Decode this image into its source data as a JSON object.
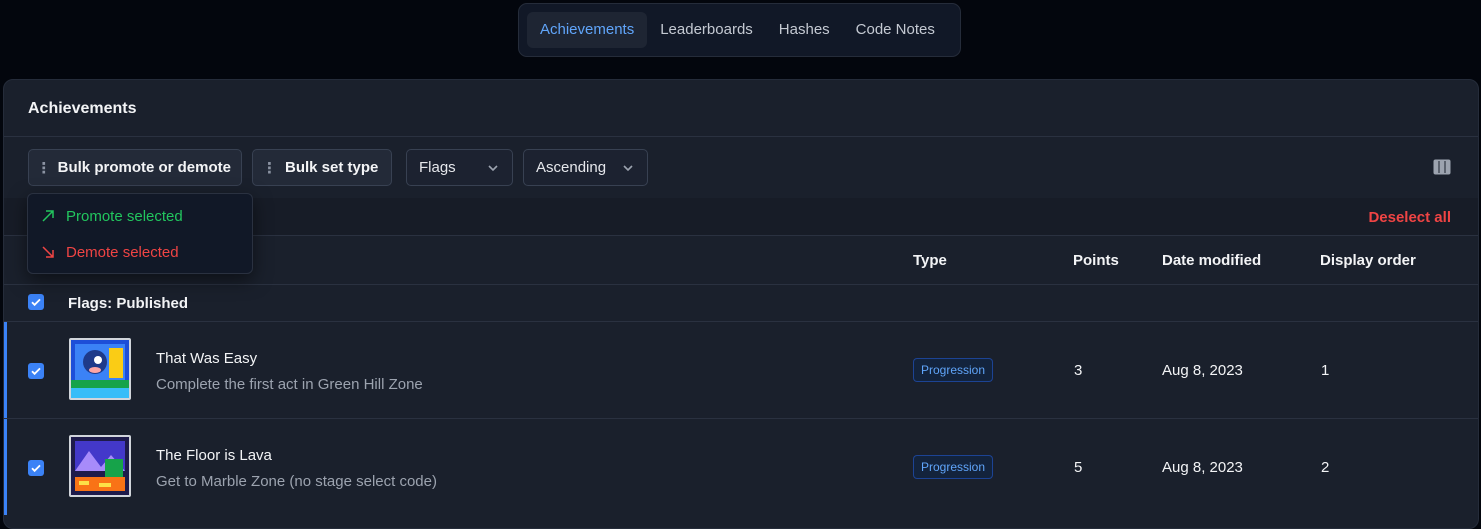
{
  "tabs": [
    {
      "label": "Achievements",
      "active": true
    },
    {
      "label": "Leaderboards",
      "active": false
    },
    {
      "label": "Hashes",
      "active": false
    },
    {
      "label": "Code Notes",
      "active": false
    }
  ],
  "card": {
    "title": "Achievements"
  },
  "toolbar": {
    "bulk_promote_label": "Bulk promote or demote",
    "bulk_type_label": "Bulk set type",
    "flags_select": "Flags",
    "order_select": "Ascending",
    "columns_icon": "columns-icon"
  },
  "menu": {
    "promote_label": "Promote selected",
    "demote_label": "Demote selected",
    "promote_color": "#22c55e",
    "demote_color": "#ef4444"
  },
  "selection": {
    "deselect_label": "Deselect all"
  },
  "table": {
    "headers": {
      "type": "Type",
      "points": "Points",
      "date": "Date modified",
      "order": "Display order"
    },
    "group_label": "Flags: Published",
    "rows": [
      {
        "title": "That Was Easy",
        "description": "Complete the first act in Green Hill Zone",
        "type": "Progression",
        "points": "3",
        "date": "Aug 8, 2023",
        "order": "1",
        "checked": true
      },
      {
        "title": "The Floor is Lava",
        "description": "Get to Marble Zone (no stage select code)",
        "type": "Progression",
        "points": "5",
        "date": "Aug 8, 2023",
        "order": "2",
        "checked": true
      }
    ]
  },
  "colors": {
    "accent": "#3b82f6",
    "tab_active": "#60a5fa",
    "danger": "#ef4444",
    "success": "#22c55e"
  }
}
